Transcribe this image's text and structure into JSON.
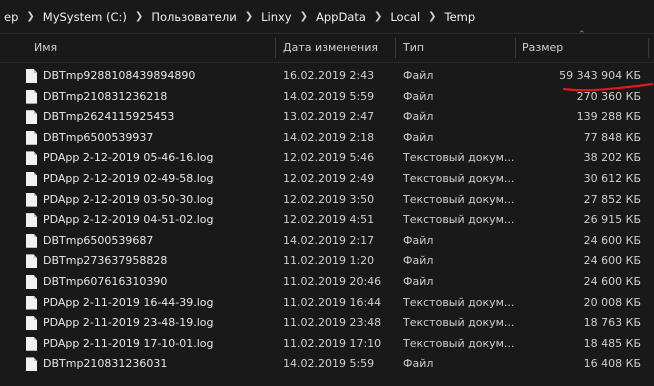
{
  "breadcrumb": {
    "items": [
      "ep",
      "MySystem (C:)",
      "Пользователи",
      "Linxy",
      "AppData",
      "Local",
      "Temp"
    ]
  },
  "columns": {
    "name": "Имя",
    "date": "Дата изменения",
    "type": "Тип",
    "size": "Размер"
  },
  "files": [
    {
      "name": "DBTmp9288108439894890",
      "date": "16.02.2019 2:43",
      "type": "Файл",
      "size": "59 343 904 КБ"
    },
    {
      "name": "DBTmp210831236218",
      "date": "14.02.2019 5:59",
      "type": "Файл",
      "size": "270 360 КБ"
    },
    {
      "name": "DBTmp2624115925453",
      "date": "13.02.2019 2:47",
      "type": "Файл",
      "size": "139 288 КБ"
    },
    {
      "name": "DBTmp6500539937",
      "date": "14.02.2019 2:18",
      "type": "Файл",
      "size": "77 848 КБ"
    },
    {
      "name": "PDApp 2-12-2019 05-46-16.log",
      "date": "12.02.2019 5:46",
      "type": "Текстовый докум...",
      "size": "38 202 КБ"
    },
    {
      "name": "PDApp 2-12-2019 02-49-58.log",
      "date": "12.02.2019 2:49",
      "type": "Текстовый докум...",
      "size": "30 612 КБ"
    },
    {
      "name": "PDApp 2-12-2019 03-50-30.log",
      "date": "12.02.2019 3:50",
      "type": "Текстовый докум...",
      "size": "27 852 КБ"
    },
    {
      "name": "PDApp 2-12-2019 04-51-02.log",
      "date": "12.02.2019 4:51",
      "type": "Текстовый докум...",
      "size": "26 915 КБ"
    },
    {
      "name": "DBTmp6500539687",
      "date": "14.02.2019 2:17",
      "type": "Файл",
      "size": "24 600 КБ"
    },
    {
      "name": "DBTmp273637958828",
      "date": "11.02.2019 1:20",
      "type": "Файл",
      "size": "24 600 КБ"
    },
    {
      "name": "DBTmp607616310390",
      "date": "11.02.2019 20:46",
      "type": "Файл",
      "size": "24 600 КБ"
    },
    {
      "name": "PDApp 2-11-2019 16-44-39.log",
      "date": "11.02.2019 16:44",
      "type": "Текстовый докум...",
      "size": "20 008 КБ"
    },
    {
      "name": "PDApp 2-11-2019 23-48-19.log",
      "date": "11.02.2019 23:48",
      "type": "Текстовый докум...",
      "size": "18 763 КБ"
    },
    {
      "name": "PDApp 2-11-2019 17-10-01.log",
      "date": "11.02.2019 17:10",
      "type": "Текстовый докум...",
      "size": "18 485 КБ"
    },
    {
      "name": "DBTmp210831236031",
      "date": "14.02.2019 5:59",
      "type": "Файл",
      "size": "16 408 КБ"
    }
  ],
  "colors": {
    "background": "#191919",
    "text": "#e6e6e6",
    "annotation": "#e0181c"
  },
  "icons": {
    "file": "file-icon",
    "sort": "chevron-up-icon",
    "separator": "chevron-right-icon"
  }
}
